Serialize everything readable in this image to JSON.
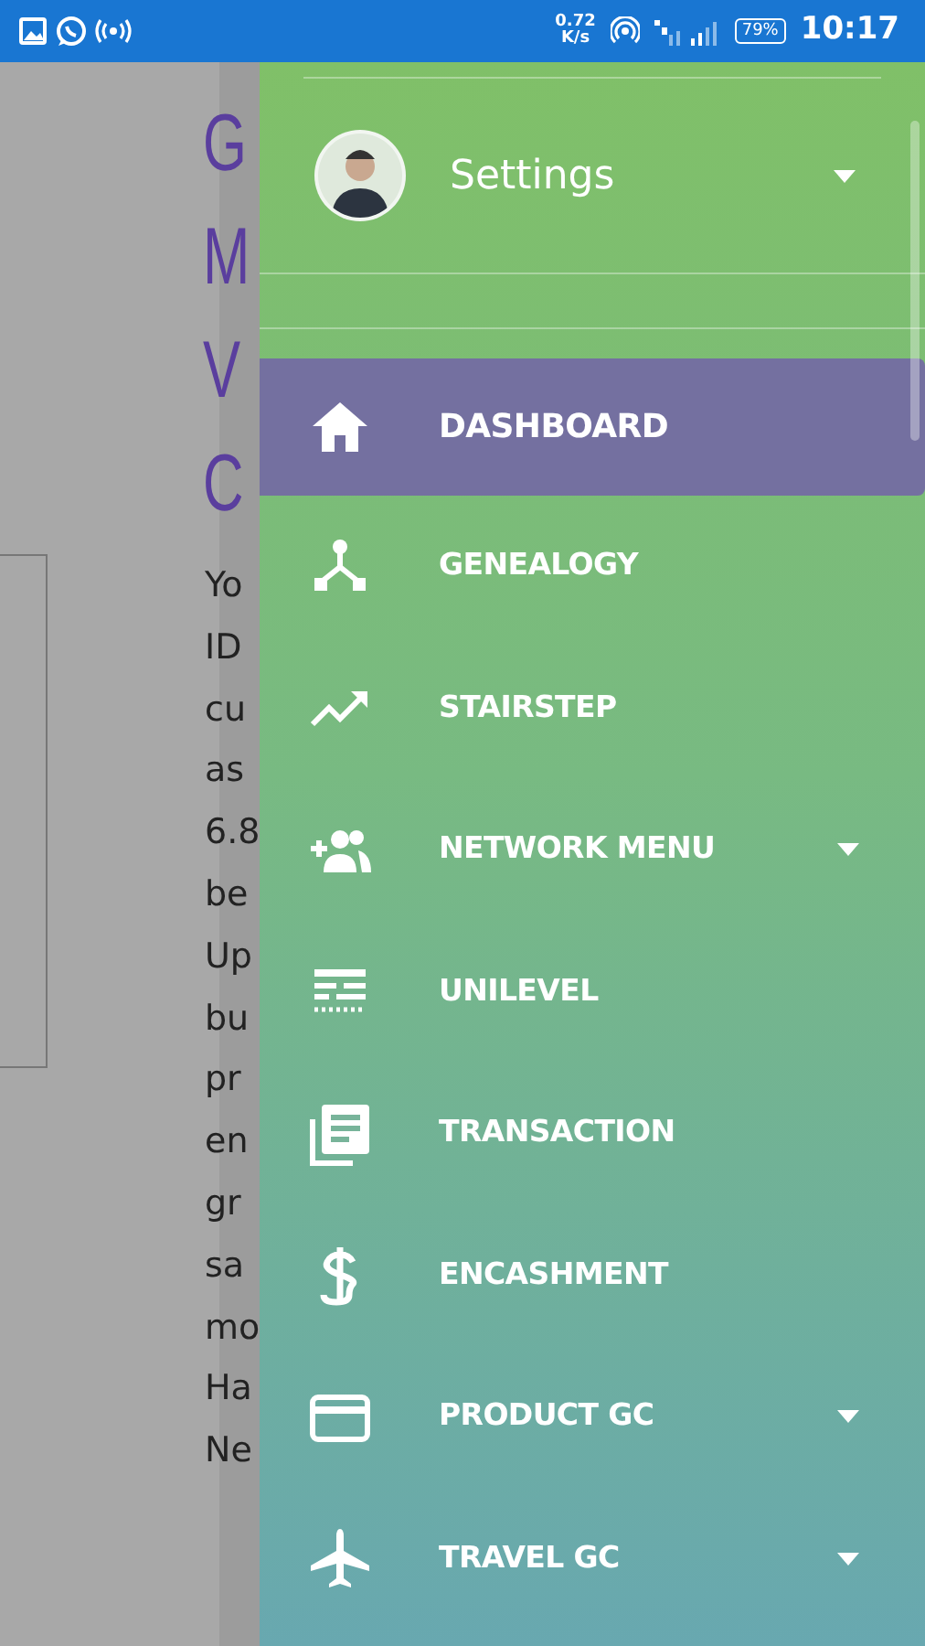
{
  "status_bar": {
    "speed": "0.72",
    "speed_unit": "K/s",
    "battery": "79%",
    "time": "10:17"
  },
  "page": {
    "greeting": [
      "G",
      "M",
      "V",
      "C"
    ],
    "message_lines": [
      "Yo",
      "ID",
      "cu",
      "as",
      "6.8",
      "be",
      "Up",
      "bu",
      "pr",
      "en",
      "gr",
      "sa",
      "mo",
      "Ha",
      "Ne"
    ]
  },
  "drawer": {
    "header": {
      "label": "Settings",
      "expandable": true
    },
    "items": [
      {
        "label": "DASHBOARD",
        "selected": true,
        "expandable": false
      },
      {
        "label": "GENEALOGY",
        "selected": false,
        "expandable": false
      },
      {
        "label": "STAIRSTEP",
        "selected": false,
        "expandable": false
      },
      {
        "label": "NETWORK MENU",
        "selected": false,
        "expandable": true
      },
      {
        "label": "UNILEVEL",
        "selected": false,
        "expandable": false
      },
      {
        "label": "TRANSACTION",
        "selected": false,
        "expandable": false
      },
      {
        "label": "ENCASHMENT",
        "selected": false,
        "expandable": false
      },
      {
        "label": "PRODUCT GC",
        "selected": false,
        "expandable": true
      },
      {
        "label": "TRAVEL GC",
        "selected": false,
        "expandable": true
      }
    ]
  }
}
